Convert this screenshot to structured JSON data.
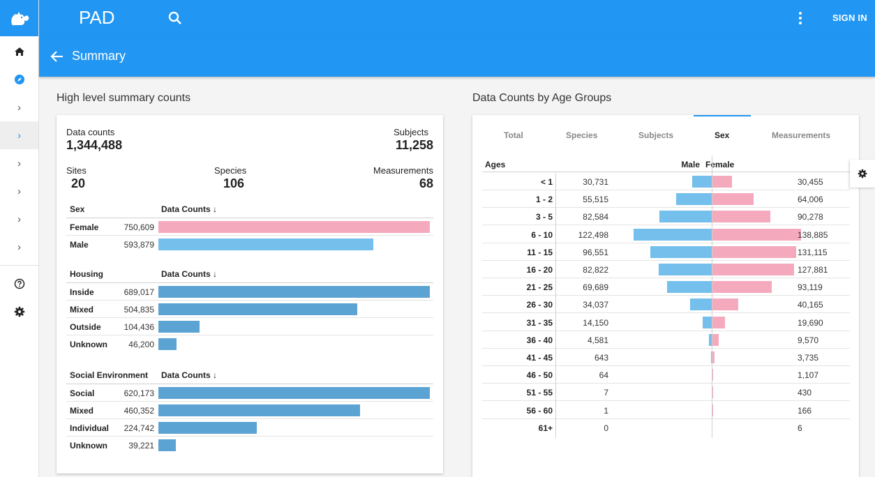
{
  "app": {
    "title": "PAD",
    "sign_in": "SIGN IN"
  },
  "subheader": {
    "title": "Summary"
  },
  "sections": {
    "left_title": "High level summary counts",
    "right_title": "Data Counts by Age Groups"
  },
  "colors": {
    "primary": "#2196f3",
    "female": "#f5a9bc",
    "male": "#74bfec",
    "bar": "#5ba3d3"
  },
  "stats": {
    "data_counts": {
      "label": "Data counts",
      "value": "1,344,488"
    },
    "subjects": {
      "label": "Subjects",
      "value": "11,258"
    },
    "sites": {
      "label": "Sites",
      "value": "20"
    },
    "species": {
      "label": "Species",
      "value": "106"
    },
    "measurements": {
      "label": "Measurements",
      "value": "68"
    }
  },
  "groups": [
    {
      "name": "Sex",
      "col": "Data Counts",
      "rows": [
        {
          "label": "Female",
          "value": "750,609",
          "n": 750609,
          "color": "#f5a9bc"
        },
        {
          "label": "Male",
          "value": "593,879",
          "n": 593879,
          "color": "#74bfec"
        }
      ]
    },
    {
      "name": "Housing",
      "col": "Data Counts",
      "rows": [
        {
          "label": "Inside",
          "value": "689,017",
          "n": 689017,
          "color": "#5ba3d3"
        },
        {
          "label": "Mixed",
          "value": "504,835",
          "n": 504835,
          "color": "#5ba3d3"
        },
        {
          "label": "Outside",
          "value": "104,436",
          "n": 104436,
          "color": "#5ba3d3"
        },
        {
          "label": "Unknown",
          "value": "46,200",
          "n": 46200,
          "color": "#5ba3d3"
        }
      ]
    },
    {
      "name": "Social Environment",
      "col": "Data Counts",
      "rows": [
        {
          "label": "Social",
          "value": "620,173",
          "n": 620173,
          "color": "#5ba3d3"
        },
        {
          "label": "Mixed",
          "value": "460,352",
          "n": 460352,
          "color": "#5ba3d3"
        },
        {
          "label": "Individual",
          "value": "224,742",
          "n": 224742,
          "color": "#5ba3d3"
        },
        {
          "label": "Unknown",
          "value": "39,221",
          "n": 39221,
          "color": "#5ba3d3"
        }
      ]
    }
  ],
  "age_tabs": [
    "Total",
    "Species",
    "Subjects",
    "Sex",
    "Measurements"
  ],
  "active_tab": "Sex",
  "age_table": {
    "headers": {
      "ages": "Ages",
      "male": "Male",
      "female": "Female"
    },
    "rows": [
      {
        "age": "< 1",
        "male": "30,731",
        "female": "30,455",
        "m": 30731,
        "f": 30455
      },
      {
        "age": "1 - 2",
        "male": "55,515",
        "female": "64,006",
        "m": 55515,
        "f": 64006
      },
      {
        "age": "3 - 5",
        "male": "82,584",
        "female": "90,278",
        "m": 82584,
        "f": 90278
      },
      {
        "age": "6 - 10",
        "male": "122,498",
        "female": "138,885",
        "m": 122498,
        "f": 138885
      },
      {
        "age": "11 - 15",
        "male": "96,551",
        "female": "131,115",
        "m": 96551,
        "f": 131115
      },
      {
        "age": "16 - 20",
        "male": "82,822",
        "female": "127,881",
        "m": 82822,
        "f": 127881
      },
      {
        "age": "21 - 25",
        "male": "69,689",
        "female": "93,119",
        "m": 69689,
        "f": 93119
      },
      {
        "age": "26 - 30",
        "male": "34,037",
        "female": "40,165",
        "m": 34037,
        "f": 40165
      },
      {
        "age": "31 - 35",
        "male": "14,150",
        "female": "19,690",
        "m": 14150,
        "f": 19690
      },
      {
        "age": "36 - 40",
        "male": "4,581",
        "female": "9,570",
        "m": 4581,
        "f": 9570
      },
      {
        "age": "41 - 45",
        "male": "643",
        "female": "3,735",
        "m": 643,
        "f": 3735
      },
      {
        "age": "46 - 50",
        "male": "64",
        "female": "1,107",
        "m": 64,
        "f": 1107
      },
      {
        "age": "51 - 55",
        "male": "7",
        "female": "430",
        "m": 7,
        "f": 430
      },
      {
        "age": "56 - 60",
        "male": "1",
        "female": "166",
        "m": 1,
        "f": 166
      },
      {
        "age": "61+",
        "male": "0",
        "female": "6",
        "m": 0,
        "f": 6
      }
    ]
  }
}
